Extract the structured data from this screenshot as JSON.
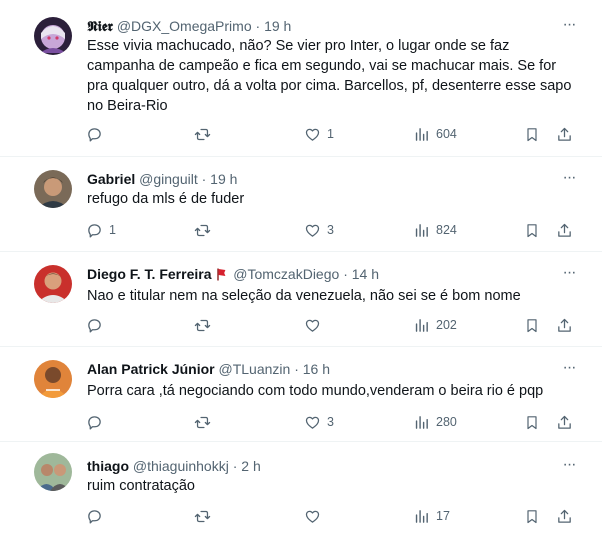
{
  "tweets": [
    {
      "name": "𝕹𝖎𝖊𝖗",
      "handle": "@DGX_OmegaPrimo",
      "dot": "·",
      "time": "19 h",
      "text": "Esse vivia machucado, não? Se vier pro Inter, o lugar onde se faz campanha de campeão e fica em segundo, vai se machucar mais. Se for pra qualquer outro, dá a volta por cima. Barcellos, pf, desenterre esse sapo no Beira-Rio",
      "replies": "",
      "retweets": "",
      "likes": "1",
      "views": "604"
    },
    {
      "name": "Gabriel",
      "handle": "@ginguilt",
      "dot": "·",
      "time": "19 h",
      "text": "refugo da mls é de fuder",
      "replies": "1",
      "retweets": "",
      "likes": "3",
      "views": "824"
    },
    {
      "name": "Diego F. T. Ferreira",
      "handle": "@TomczakDiego",
      "dot": "·",
      "time": "14 h",
      "text": "Nao e titular nem na seleção da venezuela, não sei se é bom nome",
      "replies": "",
      "retweets": "",
      "likes": "",
      "views": "202"
    },
    {
      "name": "Alan Patrick Júnior",
      "handle": "@TLuanzin",
      "dot": "·",
      "time": "16 h",
      "text": "Porra cara ,tá negociando com todo mundo,venderam o beira rio é pqp",
      "replies": "",
      "retweets": "",
      "likes": "3",
      "views": "280"
    },
    {
      "name": "thiago",
      "handle": "@thiaguinhokkj",
      "dot": "·",
      "time": "2 h",
      "text": "ruim contratação",
      "replies": "",
      "retweets": "",
      "likes": "",
      "views": "17"
    }
  ],
  "more_glyph": "···",
  "colors": {
    "text": "#0f1419",
    "muted": "#536471",
    "divider": "#eff3f4",
    "flag": "#d6212e"
  },
  "icons": [
    "reply-icon",
    "retweet-icon",
    "like-icon",
    "views-icon",
    "bookmark-icon",
    "share-icon",
    "more-icon"
  ]
}
